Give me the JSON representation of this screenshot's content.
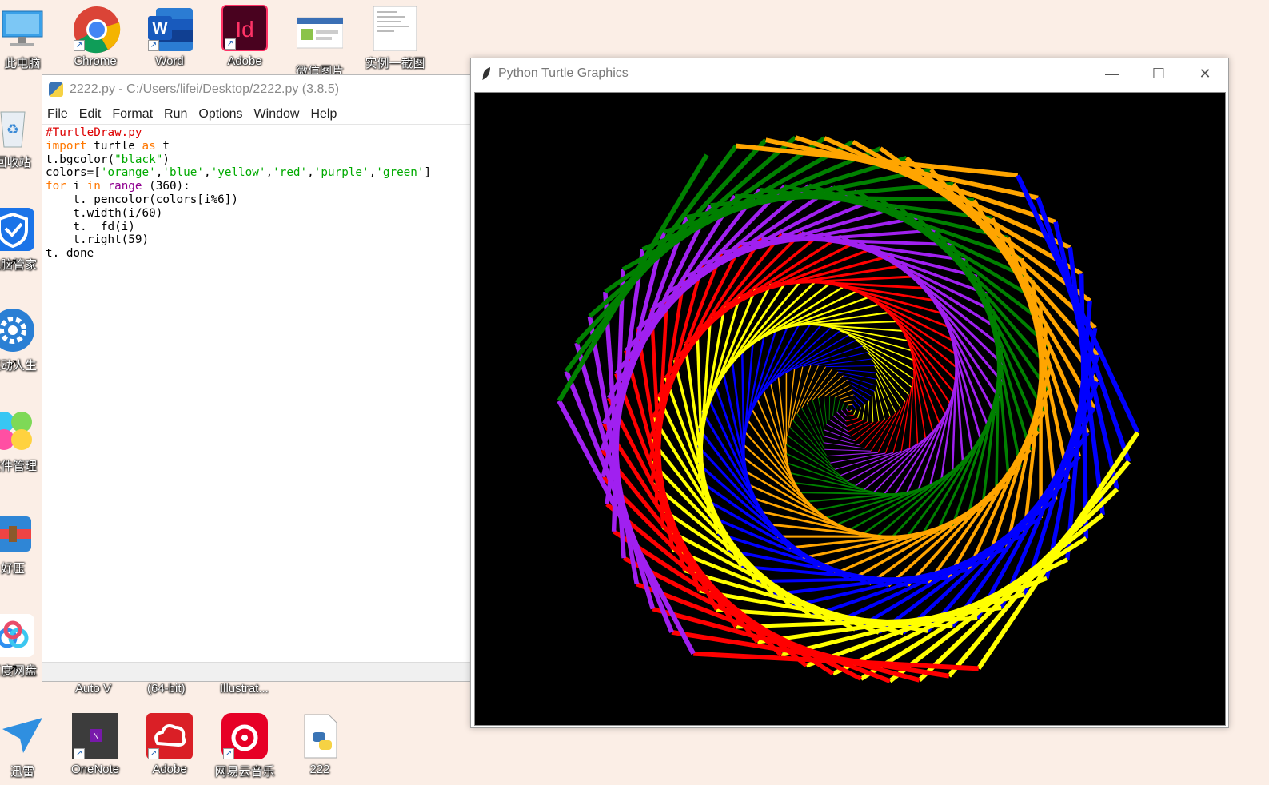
{
  "desktop": {
    "top_icons": [
      {
        "label": "此电脑",
        "icon": "computer-icon"
      },
      {
        "label": "Chrome",
        "icon": "chrome-icon"
      },
      {
        "label": "Word",
        "icon": "word-icon"
      },
      {
        "label": "Adobe",
        "icon": "indesign-icon"
      },
      {
        "label": "微信图片",
        "icon": "image-thumbnail-icon"
      },
      {
        "label": "实例一截图",
        "icon": "document-thumbnail-icon"
      }
    ],
    "side_icons": [
      {
        "label": "回收站",
        "icon": "recycle-bin-icon"
      },
      {
        "label": "电脑管家",
        "icon": "shield-icon"
      },
      {
        "label": "驱动人生",
        "icon": "gear-icon"
      },
      {
        "label": "软件管理",
        "icon": "clover-icon"
      },
      {
        "label": "好压",
        "icon": "archive-icon"
      },
      {
        "label": "百度网盘",
        "icon": "cloud-icon"
      }
    ],
    "bottom_row_labels": [
      "Auto V",
      "(64-bit)",
      "Illustrat..."
    ],
    "bottom_icons": [
      {
        "label": "迅雷",
        "icon": "bird-icon"
      },
      {
        "label": "OneNote",
        "icon": "onenote-icon"
      },
      {
        "label": "Adobe",
        "icon": "creative-cloud-icon"
      },
      {
        "label": "网易云音乐",
        "icon": "music-icon"
      },
      {
        "label": "222",
        "icon": "python-file-icon"
      }
    ]
  },
  "idle_window": {
    "title": "2222.py - C:/Users/lifei/Desktop/2222.py (3.8.5)",
    "menu": [
      "File",
      "Edit",
      "Format",
      "Run",
      "Options",
      "Window",
      "Help"
    ],
    "code": {
      "line1": "#TurtleDraw.py",
      "import_kw": "import",
      "import_mod": " turtle ",
      "as_kw": "as",
      "import_alias": " t",
      "bgcolor_pre": "t.bgcolor(",
      "bgcolor_arg": "\"black\"",
      "bgcolor_post": ")",
      "colors_pre": "colors=[",
      "colors_items": [
        "'orange'",
        "'blue'",
        "'yellow'",
        "'red'",
        "'purple'",
        "'green'"
      ],
      "colors_post": "]",
      "for_kw": "for",
      "for_var": " i ",
      "in_kw": "in",
      "range_bi": " range",
      "for_post": " (360):",
      "body1": "    t. pencolor(colors[i%6])",
      "body2": "    t.width(i/60)",
      "body3": "    t.  fd(i)",
      "body4": "    t.right(59)",
      "last": "t. done"
    }
  },
  "turtle_window": {
    "title": "Python Turtle Graphics",
    "controls": {
      "minimize": "—",
      "maximize": "☐",
      "close": "✕"
    },
    "background": "#000000",
    "palette": [
      "#ffa500",
      "#0000ff",
      "#ffff00",
      "#ff0000",
      "#a020f0",
      "#008000"
    ],
    "program": {
      "steps": 360,
      "turn_degrees": 59,
      "width_divisor": 60
    }
  }
}
